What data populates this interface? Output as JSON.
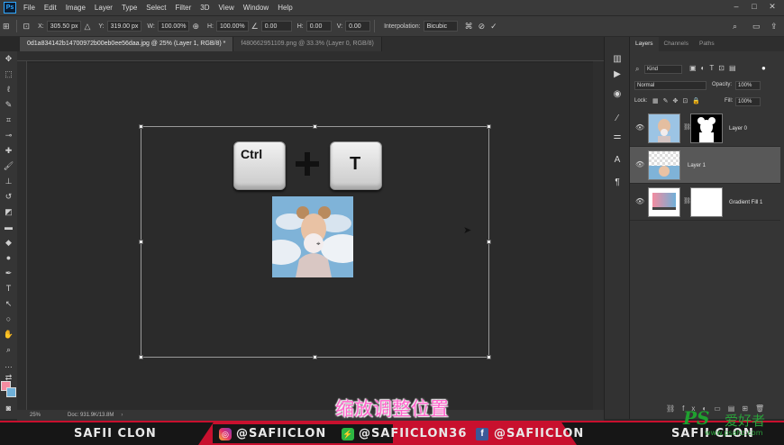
{
  "app": {
    "logo": "Ps"
  },
  "menu": [
    "File",
    "Edit",
    "Image",
    "Layer",
    "Type",
    "Select",
    "Filter",
    "3D",
    "View",
    "Window",
    "Help"
  ],
  "options": {
    "x_label": "X:",
    "x_value": "305.50 px",
    "y_label": "Y:",
    "y_value": "319.00 px",
    "w_label": "W:",
    "w_value": "100.00%",
    "h_label": "H:",
    "h_value": "100.00%",
    "angle_value": "0.00",
    "hskew_label": "H:",
    "hskew_value": "0.00",
    "vskew_label": "V:",
    "vskew_value": "0.00",
    "interpolation_label": "Interpolation:",
    "interpolation_value": "Bicubic"
  },
  "tabs": [
    {
      "label": "0d1a834142b14700972b00eb0ee56daa.jpg @ 25% (Layer 1, RGB/8) *"
    },
    {
      "label": "f480662951109.png @ 33.3% (Layer 0, RGB/8)"
    }
  ],
  "canvas": {
    "key_ctrl": "Ctrl",
    "key_t": "T"
  },
  "status": {
    "zoom": "25%",
    "doc": "Doc: 931.9K/13.8M"
  },
  "panels": {
    "tabs": [
      "Layers",
      "Channels",
      "Paths"
    ],
    "kind_label": "Kind",
    "blend_mode": "Normal",
    "opacity_label": "Opacity:",
    "opacity_value": "100%",
    "lock_label": "Lock:",
    "fill_label": "Fill:",
    "fill_value": "100%",
    "layers": [
      {
        "name": "Layer 0"
      },
      {
        "name": "Layer 1"
      },
      {
        "name": "Gradient Fill 1"
      }
    ]
  },
  "caption": "缩放调整位置",
  "banner": {
    "left": "SAFII CLON",
    "instagram": "@SAFIICLON",
    "other": "@SAFIICLON36",
    "facebook": "@SAFIICLON",
    "right": "SAFII CLON"
  },
  "watermark": {
    "brand": "PS",
    "chinese": "爱好者",
    "url": "www.psahz.com"
  },
  "colors": {
    "accent_red": "#c8102e",
    "caption_pink": "#ff66cc",
    "ps_blue": "#31a8ff",
    "watermark_green": "#1fa12f"
  }
}
